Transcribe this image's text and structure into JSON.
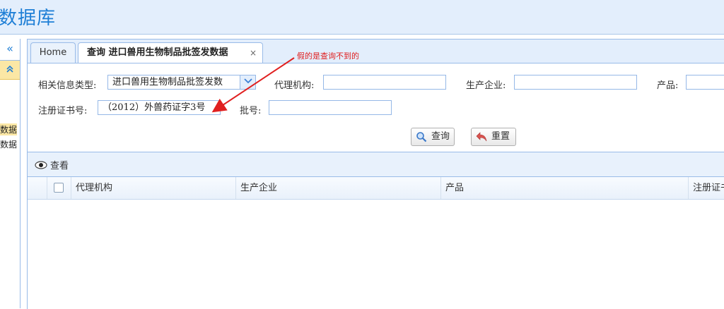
{
  "header": {
    "title": "数据库"
  },
  "sidebar": {
    "collapse_glyph": "«",
    "accordion_glyph": "⌃",
    "items": [
      {
        "label": "数据"
      },
      {
        "label": "数据"
      }
    ]
  },
  "tabs": [
    {
      "label": "Home"
    },
    {
      "label": "查询 进口兽用生物制品批签发数据",
      "close": "×"
    }
  ],
  "annotation": {
    "text": "假的是查询不到的",
    "color": "#e02020"
  },
  "form": {
    "info_type_label": "相关信息类型:",
    "info_type_value": "进口兽用生物制品批签发数",
    "agency_label": "代理机构:",
    "agency_value": "",
    "manufacturer_label": "生产企业:",
    "manufacturer_value": "",
    "product_label": "产品:",
    "product_value": "",
    "reg_cert_label": "注册证书号:",
    "reg_cert_value": "（2012）外兽药证字3号",
    "batch_label": "批号:",
    "batch_value": "",
    "query_button": "查询",
    "reset_button": "重置"
  },
  "toolbar": {
    "view_label": "查看"
  },
  "grid": {
    "columns": [
      "代理机构",
      "生产企业",
      "产品",
      "注册证书号"
    ],
    "rows": []
  },
  "colors": {
    "accent": "#1f7fd6",
    "header_bg": "#e3eefc",
    "border": "#99bbe8"
  }
}
